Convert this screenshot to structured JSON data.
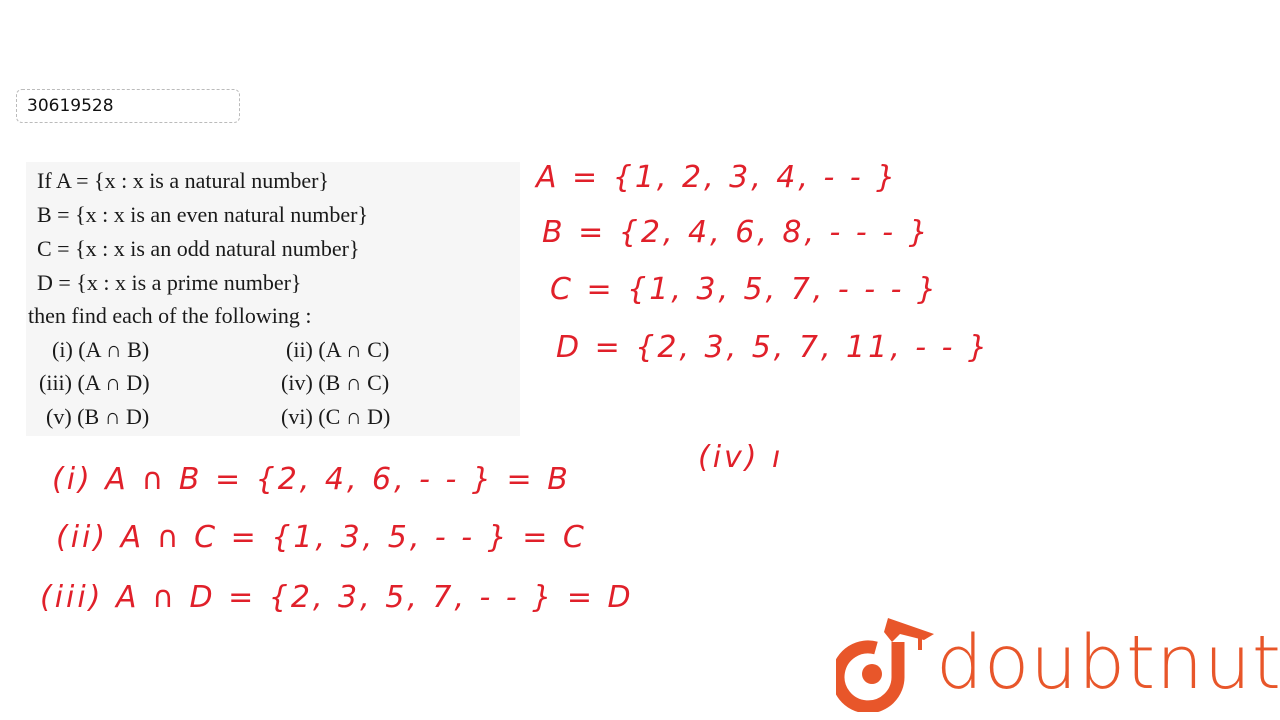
{
  "question_id": "30619528",
  "question": {
    "lines": [
      "If A = {x : x is a natural number}",
      "B = {x : x is an even natural number}",
      "C = {x : x is an odd natural number}",
      "D = {x : x is a prime number}",
      "then find each of the following :"
    ],
    "options": [
      "(i) (A ∩ B)",
      "(ii) (A ∩ C)",
      "(iii) (A ∩ D)",
      "(iv) (B ∩ C)",
      "(v) (B ∩ D)",
      "(vi) (C ∩ D)"
    ]
  },
  "handwriting": {
    "sets": [
      "A = {1, 2, 3, 4, - - }",
      "B = {2, 4, 6, 8, - - - }",
      "C = {1, 3, 5, 7, - - - }",
      "D = {2, 3, 5, 7, 11, - -  }"
    ],
    "answers": [
      "(i)  A ∩ B = {2, 4, 6, - - } = B",
      "(ii)  A ∩ C = {1, 3, 5, - - } = C",
      "(iii)  A ∩ D = {2, 3, 5, 7, - - } = D"
    ],
    "partial": "(iv)  ı"
  },
  "brand": {
    "name": "doubtnut",
    "color": "#e8562a",
    "ink_color": "#e0202a"
  }
}
